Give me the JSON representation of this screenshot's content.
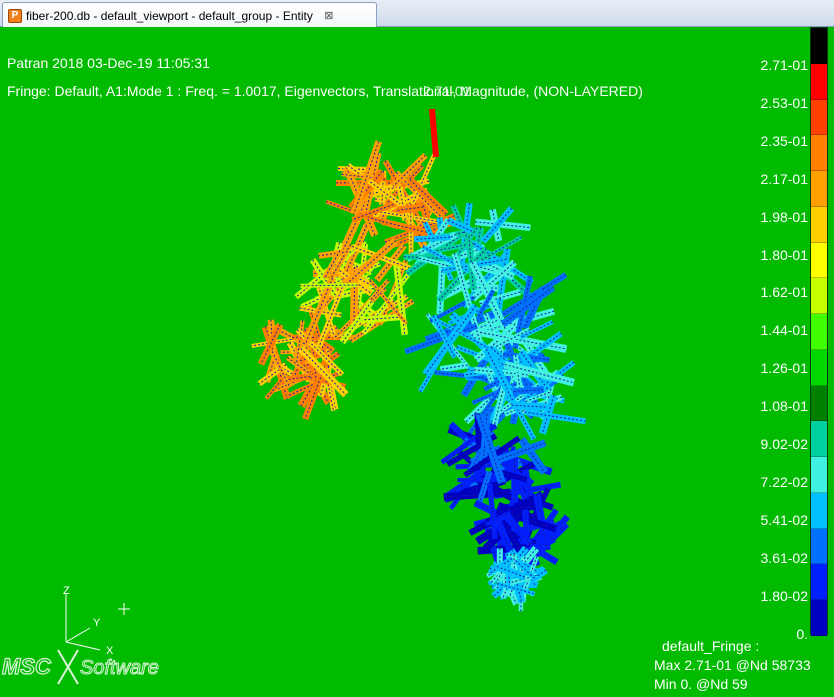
{
  "tab": {
    "title": "fiber-200.db - default_viewport - default_group - Entity",
    "icon": "patran-document-icon",
    "close_icon": "close-icon",
    "close_glyph": "⊠"
  },
  "viewport": {
    "background": "#00bb00",
    "header_line1": "Patran 2018 03-Dec-19 11:05:31",
    "header_line2": "Fringe: Default, A1:Mode 1 : Freq. = 1.0017, Eigenvectors, Translational, Magnitude, (NON-LAYERED)",
    "node_label": "2.71-01"
  },
  "colorbar": {
    "segments": [
      {
        "color": "#000000"
      },
      {
        "color": "#ff0000"
      },
      {
        "color": "#ff4000"
      },
      {
        "color": "#ff8000"
      },
      {
        "color": "#ffa000"
      },
      {
        "color": "#ffd000"
      },
      {
        "color": "#ffff00"
      },
      {
        "color": "#c8ff00"
      },
      {
        "color": "#40ff00"
      },
      {
        "color": "#00d800"
      },
      {
        "color": "#008000"
      },
      {
        "color": "#00d0a0"
      },
      {
        "color": "#40f0e0"
      },
      {
        "color": "#00c0ff"
      },
      {
        "color": "#0070ff"
      },
      {
        "color": "#0020ff"
      },
      {
        "color": "#0000c0"
      }
    ],
    "labels": [
      "2.71-01",
      "2.53-01",
      "2.35-01",
      "2.17-01",
      "1.98-01",
      "1.80-01",
      "1.62-01",
      "1.44-01",
      "1.26-01",
      "1.08-01",
      "9.02-02",
      "7.22-02",
      "5.41-02",
      "3.61-02",
      "1.80-02",
      "0."
    ]
  },
  "fringe_info": {
    "name": "default_Fringe :",
    "max": "Max 2.71-01 @Nd 58733",
    "min": "Min  0. @Nd 59"
  },
  "triad": {
    "z": "Z",
    "y": "Y",
    "x": "X"
  },
  "logo": {
    "part1": "MSC",
    "part2": "Software"
  }
}
